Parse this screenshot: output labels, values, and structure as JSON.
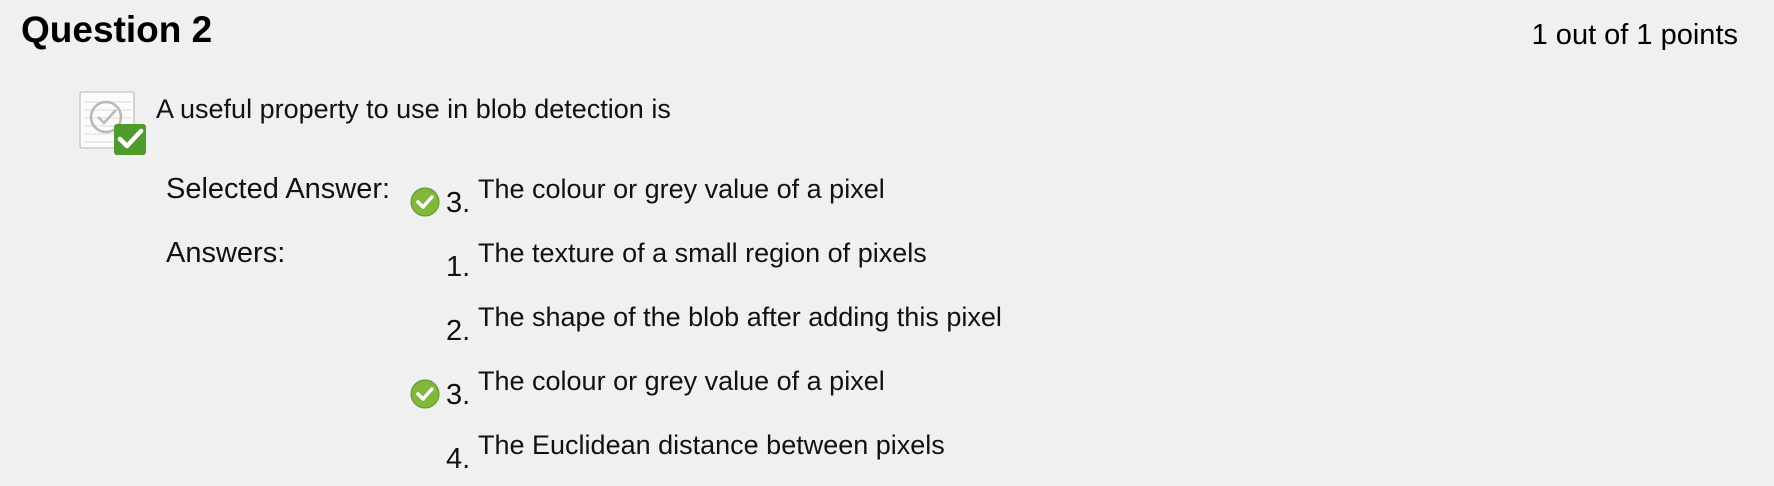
{
  "question": {
    "title": "Question 2",
    "points": "1 out of 1 points",
    "text": "A useful property to use in blob detection is"
  },
  "selected": {
    "label": "Selected Answer:",
    "number": "3.",
    "text": "The colour or grey value of a pixel"
  },
  "answers": {
    "label": "Answers:",
    "items": [
      {
        "number": "1.",
        "text": "The texture of a small region of pixels"
      },
      {
        "number": "2.",
        "text": "The shape of the blob after adding this pixel"
      },
      {
        "number": "3.",
        "text": "The colour or grey value of a pixel"
      },
      {
        "number": "4.",
        "text": "The Euclidean distance between pixels"
      }
    ]
  },
  "icons": {
    "question_status": "graded-correct-icon",
    "answer_mark": "correct-check-icon"
  },
  "colors": {
    "background": "#f0f0f0",
    "check_green": "#7fb83a",
    "status_green": "#4f9b2c"
  }
}
